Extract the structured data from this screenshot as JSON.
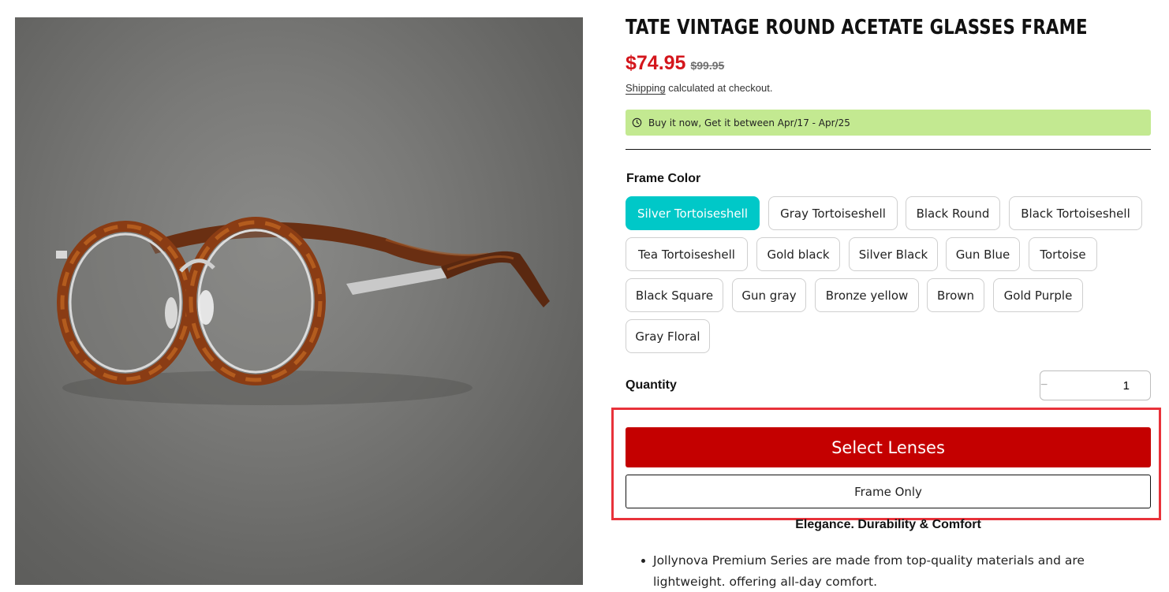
{
  "product": {
    "title": "TATE VINTAGE ROUND ACETATE GLASSES FRAME",
    "price_sale": "$74.95",
    "price_regular": "$99.95",
    "shipping_link": "Shipping",
    "shipping_note": "calculated at checkout.",
    "delivery_message": "Buy it now, Get it between Apr/17 - Apr/25"
  },
  "frame_color": {
    "label": "Frame Color",
    "selected": "Silver Tortoiseshell",
    "options": [
      "Silver Tortoiseshell",
      "Gray Tortoiseshell",
      "Black Round",
      "Black Tortoiseshell",
      "Tea Tortoiseshell",
      "Gold black",
      "Silver Black",
      "Gun Blue",
      "Tortoise",
      "Black Square",
      "Gun gray",
      "Bronze yellow",
      "Brown",
      "Gold Purple",
      "Gray Floral"
    ]
  },
  "quantity": {
    "label": "Quantity",
    "value": "1",
    "minus": "−",
    "plus": "+"
  },
  "actions": {
    "select_lenses": "Select Lenses",
    "frame_only": "Frame Only"
  },
  "description": {
    "tagline": "Elegance. Durability & Comfort",
    "features": [
      "Jollynova Premium Series are made from top-quality materials and are lightweight. offering all-day comfort."
    ]
  },
  "colors": {
    "sale_price": "#d4161c",
    "selected_swatch": "#00c8c8",
    "primary_button": "#c40000",
    "delivery_banner": "#c3e991",
    "highlight_box": "#e8323a"
  },
  "icons": {
    "delivery": "clock-icon"
  }
}
